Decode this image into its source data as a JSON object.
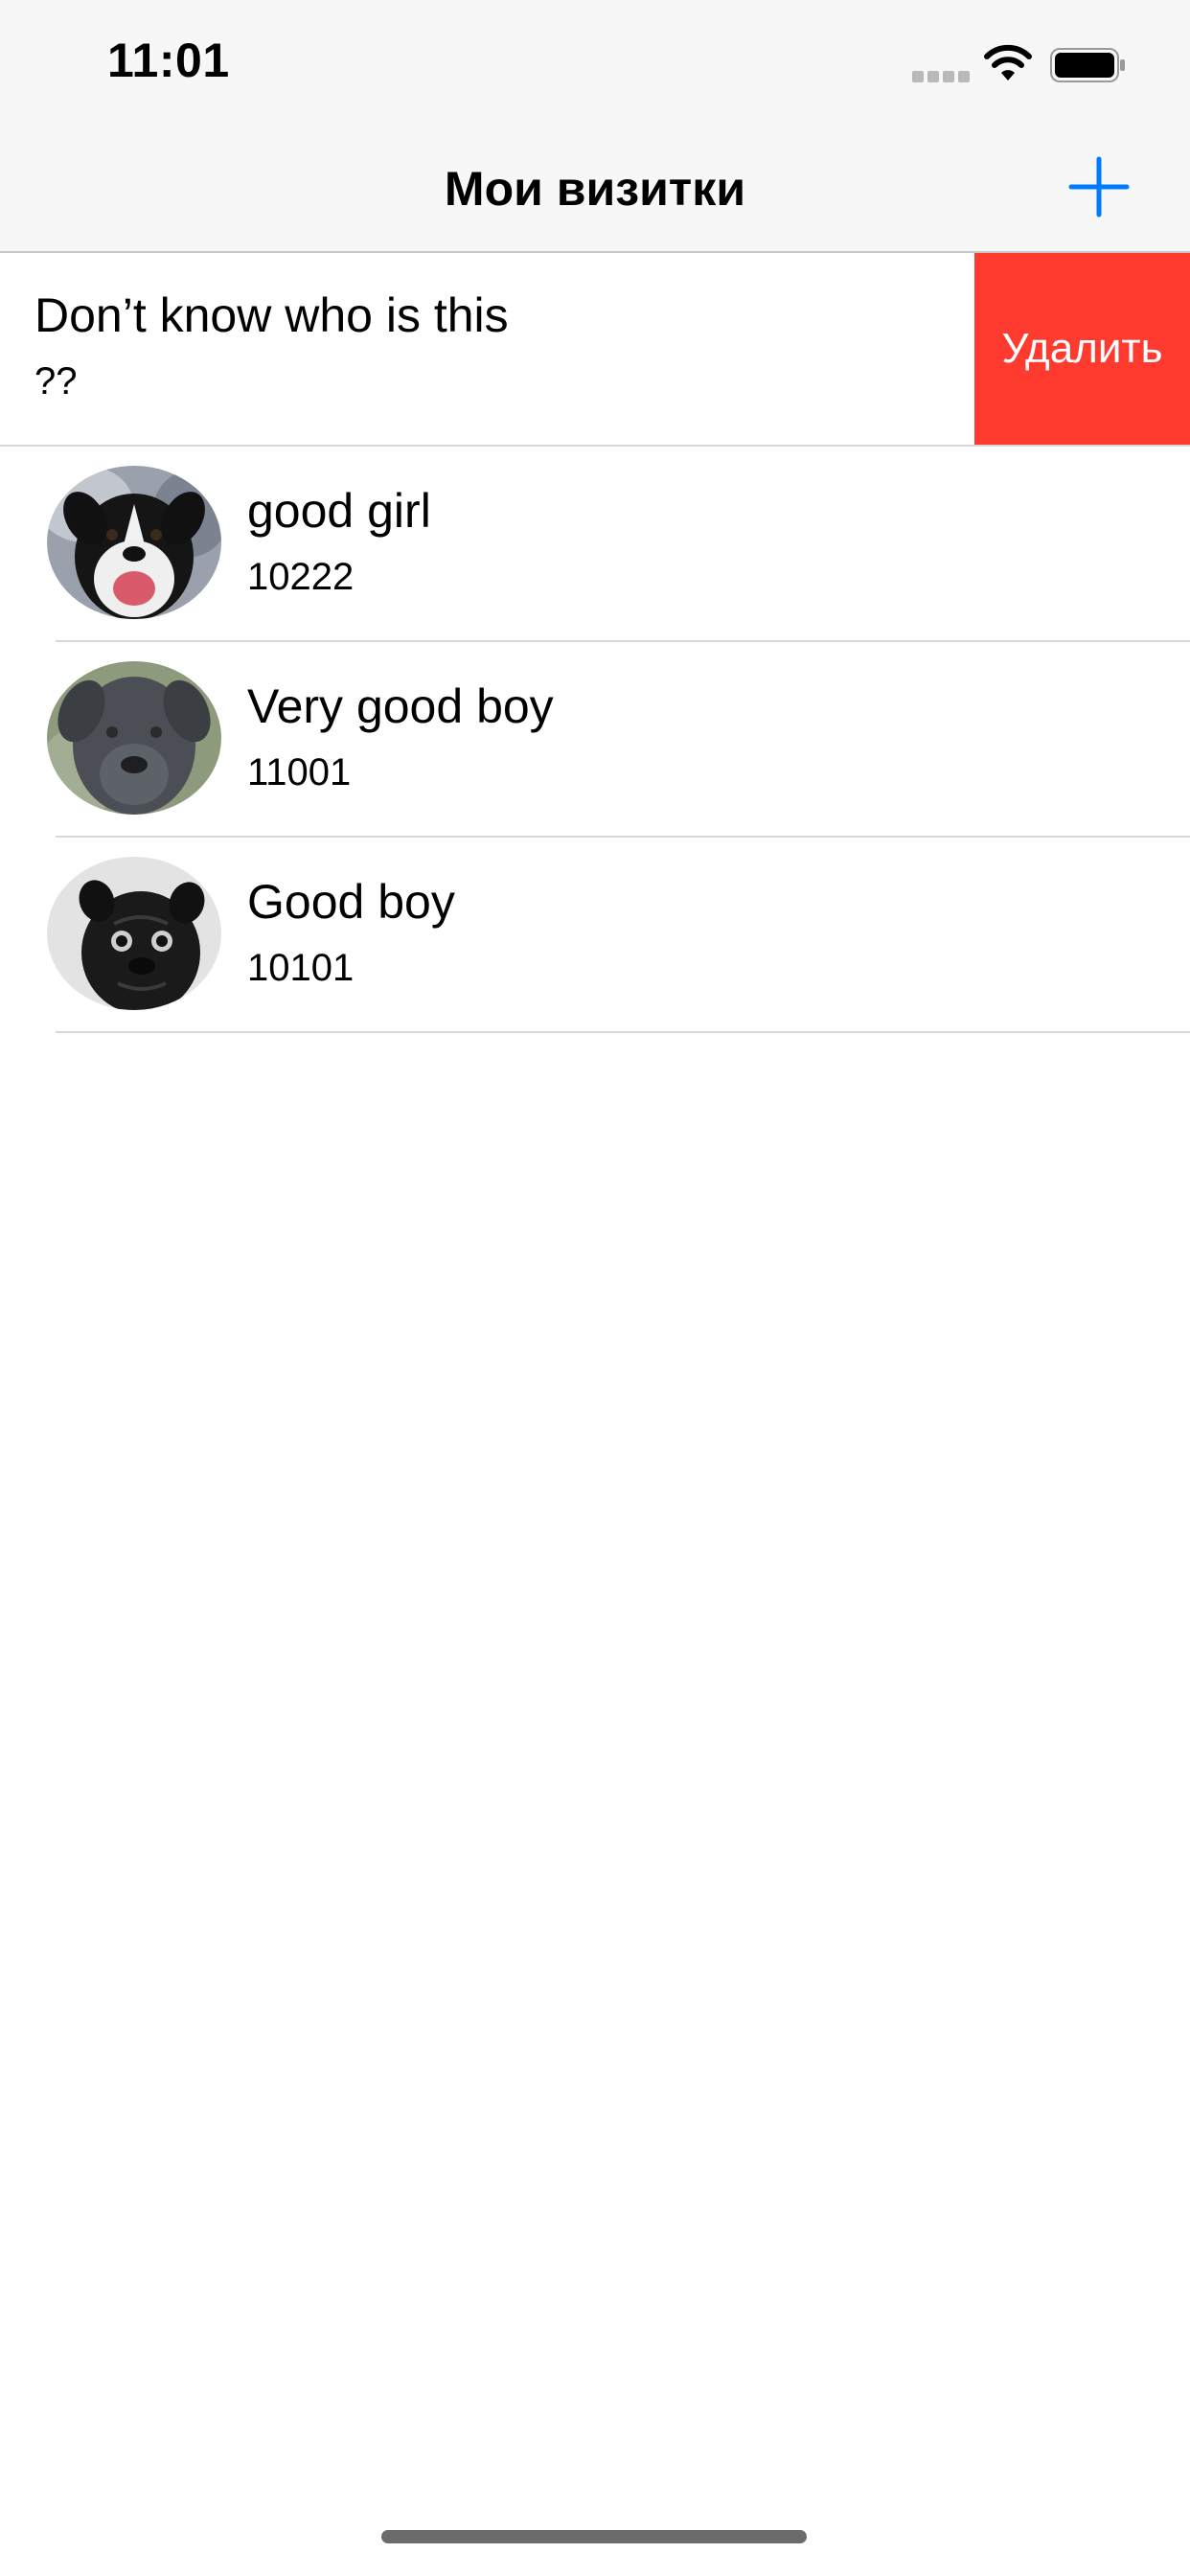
{
  "status_bar": {
    "time": "11:01",
    "icons": [
      "signal-icon",
      "wifi-icon",
      "battery-icon"
    ]
  },
  "nav_bar": {
    "title": "Мои визитки",
    "add_icon": "plus-icon",
    "accent_color": "#007aff"
  },
  "swiped_card": {
    "title": "Don’t know who is this",
    "subtitle": "??",
    "delete_label": "Удалить",
    "delete_color": "#ff3b30"
  },
  "cards": [
    {
      "name": "good girl",
      "number": "10222",
      "avatar": "border-collie-photo"
    },
    {
      "name": "Very good boy",
      "number": "11001",
      "avatar": "cane-corso-photo"
    },
    {
      "name": "Good boy",
      "number": "10101",
      "avatar": "pug-photo"
    }
  ]
}
